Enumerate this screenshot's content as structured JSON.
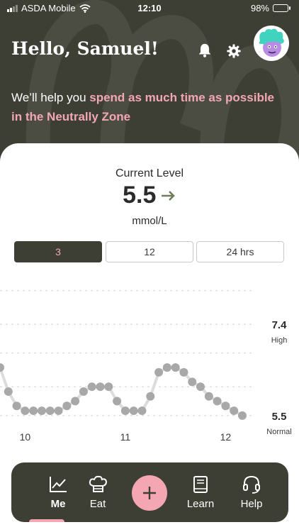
{
  "status": {
    "carrier": "ASDA Mobile",
    "time": "12:10",
    "battery": "98%",
    "battery_level": 0.98
  },
  "header": {
    "greeting": "Hello, Samuel!",
    "tagline_prefix": "We’ll help you ",
    "tagline_highlight": "spend as much time as possible in the Neutrally Zone"
  },
  "reading": {
    "label": "Current Level",
    "value": "5.5",
    "trend": "steady",
    "unit": "mmol/L"
  },
  "ranges": [
    "3",
    "12",
    "24 hrs"
  ],
  "selected_range": "3",
  "chart_data": {
    "type": "line",
    "x": [
      "09:45",
      "09:50",
      "09:55",
      "10:00",
      "10:05",
      "10:10",
      "10:15",
      "10:20",
      "10:25",
      "10:30",
      "10:35",
      "10:40",
      "10:45",
      "10:50",
      "10:55",
      "11:00",
      "11:05",
      "11:10",
      "11:15",
      "11:20",
      "11:25",
      "11:30",
      "11:35",
      "11:40",
      "11:45",
      "11:50",
      "11:55",
      "12:00",
      "12:05",
      "12:10"
    ],
    "values": [
      6.5,
      6.0,
      5.7,
      5.6,
      5.6,
      5.6,
      5.6,
      5.6,
      5.7,
      5.8,
      6.0,
      6.1,
      6.1,
      6.1,
      5.8,
      5.6,
      5.6,
      5.6,
      5.9,
      6.4,
      6.5,
      6.5,
      6.4,
      6.2,
      6.1,
      5.9,
      5.8,
      5.7,
      5.6,
      5.5
    ],
    "xtick_labels": [
      "10",
      "11",
      "12"
    ],
    "xtick_positions": [
      "10:00",
      "11:00",
      "12:00"
    ],
    "ref_lines": [
      {
        "value": "7.4",
        "label": "High"
      },
      {
        "value": "5.5",
        "label": "Normal"
      }
    ],
    "ylim": [
      5.35,
      8.45
    ],
    "grid": true
  },
  "nav": {
    "items": [
      {
        "label": "Me",
        "icon": "chart-icon",
        "active": true
      },
      {
        "label": "Eat",
        "icon": "chef-hat-icon",
        "active": false
      },
      {
        "label": "Learn",
        "icon": "book-icon",
        "active": false
      },
      {
        "label": "Help",
        "icon": "headset-icon",
        "active": false
      }
    ],
    "add_icon": "plus-icon"
  },
  "colors": {
    "dark": "#3d3f35",
    "pink": "#f4a7b2",
    "dot": "#a8a8a8",
    "arrow": "#6f7d5c"
  }
}
